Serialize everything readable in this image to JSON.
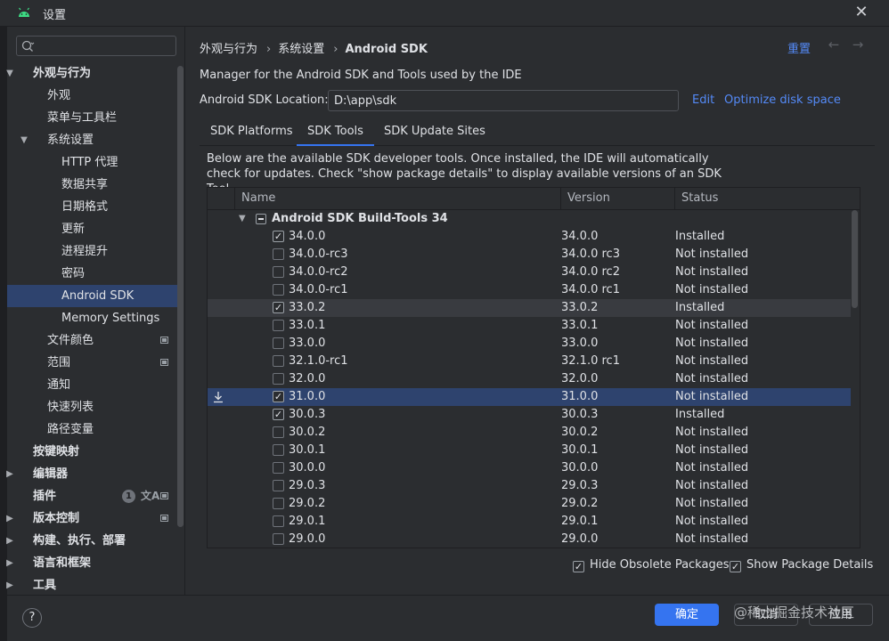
{
  "window": {
    "title": "设置"
  },
  "sidebar": {
    "search_placeholder": "",
    "items": [
      {
        "label": "外观与行为",
        "level": 0,
        "bold": true,
        "chevron": "open"
      },
      {
        "label": "外观",
        "level": 1
      },
      {
        "label": "菜单与工具栏",
        "level": 1
      },
      {
        "label": "系统设置",
        "level": 1,
        "chevron": "open"
      },
      {
        "label": "HTTP 代理",
        "level": 2
      },
      {
        "label": "数据共享",
        "level": 2
      },
      {
        "label": "日期格式",
        "level": 2
      },
      {
        "label": "更新",
        "level": 2
      },
      {
        "label": "进程提升",
        "level": 2
      },
      {
        "label": "密码",
        "level": 2
      },
      {
        "label": "Android SDK",
        "level": 2,
        "selected": true
      },
      {
        "label": "Memory Settings",
        "level": 2
      },
      {
        "label": "文件颜色",
        "level": 1,
        "box": true
      },
      {
        "label": "范围",
        "level": 1,
        "box": true
      },
      {
        "label": "通知",
        "level": 1
      },
      {
        "label": "快速列表",
        "level": 1
      },
      {
        "label": "路径变量",
        "level": 1
      },
      {
        "label": "按键映射",
        "level": 0,
        "bold": true
      },
      {
        "label": "编辑器",
        "level": 0,
        "bold": true,
        "chevron": "closed"
      },
      {
        "label": "插件",
        "level": 0,
        "bold": true,
        "badge": "1",
        "box": true
      },
      {
        "label": "版本控制",
        "level": 0,
        "bold": true,
        "chevron": "closed",
        "box": true
      },
      {
        "label": "构建、执行、部署",
        "level": 0,
        "bold": true,
        "chevron": "closed"
      },
      {
        "label": "语言和框架",
        "level": 0,
        "bold": true,
        "chevron": "closed"
      },
      {
        "label": "工具",
        "level": 0,
        "bold": true,
        "chevron": "closed"
      }
    ]
  },
  "breadcrumb": [
    "外观与行为",
    "系统设置",
    "Android SDK"
  ],
  "header": {
    "reset": "重置"
  },
  "description": "Manager for the Android SDK and Tools used by the IDE",
  "location": {
    "label": "Android SDK Location:",
    "value": "D:\\app\\sdk",
    "edit": "Edit",
    "optimize": "Optimize disk space"
  },
  "tabs": [
    {
      "label": "SDK Platforms",
      "active": false
    },
    {
      "label": "SDK Tools",
      "active": true
    },
    {
      "label": "SDK Update Sites",
      "active": false
    }
  ],
  "info_text": "Below are the available SDK developer tools. Once installed, the IDE will automatically check for updates. Check \"show package details\" to display available versions of an SDK Tool.",
  "table": {
    "columns": [
      "Name",
      "Version",
      "Status"
    ],
    "group": "Android SDK Build-Tools 34",
    "rows": [
      {
        "name": "34.0.0",
        "version": "34.0.0",
        "status": "Installed",
        "checked": true
      },
      {
        "name": "34.0.0-rc3",
        "version": "34.0.0 rc3",
        "status": "Not installed",
        "checked": false
      },
      {
        "name": "34.0.0-rc2",
        "version": "34.0.0 rc2",
        "status": "Not installed",
        "checked": false
      },
      {
        "name": "34.0.0-rc1",
        "version": "34.0.0 rc1",
        "status": "Not installed",
        "checked": false
      },
      {
        "name": "33.0.2",
        "version": "33.0.2",
        "status": "Installed",
        "checked": true,
        "hover": true
      },
      {
        "name": "33.0.1",
        "version": "33.0.1",
        "status": "Not installed",
        "checked": false
      },
      {
        "name": "33.0.0",
        "version": "33.0.0",
        "status": "Not installed",
        "checked": false
      },
      {
        "name": "32.1.0-rc1",
        "version": "32.1.0 rc1",
        "status": "Not installed",
        "checked": false
      },
      {
        "name": "32.0.0",
        "version": "32.0.0",
        "status": "Not installed",
        "checked": false
      },
      {
        "name": "31.0.0",
        "version": "31.0.0",
        "status": "Not installed",
        "checked": true,
        "selected": true,
        "download": true
      },
      {
        "name": "30.0.3",
        "version": "30.0.3",
        "status": "Installed",
        "checked": true
      },
      {
        "name": "30.0.2",
        "version": "30.0.2",
        "status": "Not installed",
        "checked": false
      },
      {
        "name": "30.0.1",
        "version": "30.0.1",
        "status": "Not installed",
        "checked": false
      },
      {
        "name": "30.0.0",
        "version": "30.0.0",
        "status": "Not installed",
        "checked": false
      },
      {
        "name": "29.0.3",
        "version": "29.0.3",
        "status": "Not installed",
        "checked": false
      },
      {
        "name": "29.0.2",
        "version": "29.0.2",
        "status": "Not installed",
        "checked": false
      },
      {
        "name": "29.0.1",
        "version": "29.0.1",
        "status": "Not installed",
        "checked": false
      },
      {
        "name": "29.0.0",
        "version": "29.0.0",
        "status": "Not installed",
        "checked": false
      }
    ]
  },
  "options": {
    "hide_obsolete": {
      "label": "Hide Obsolete Packages",
      "checked": true
    },
    "show_details": {
      "label": "Show Package Details",
      "checked": true
    }
  },
  "footer": {
    "help": "?",
    "ok": "确定",
    "cancel": "取消",
    "apply": "应用",
    "watermark": "@稀土掘金技术社区"
  },
  "colors": {
    "accent": "#3574f0",
    "link": "#548af7",
    "selection": "#2e436e",
    "background": "#2b2d30"
  }
}
